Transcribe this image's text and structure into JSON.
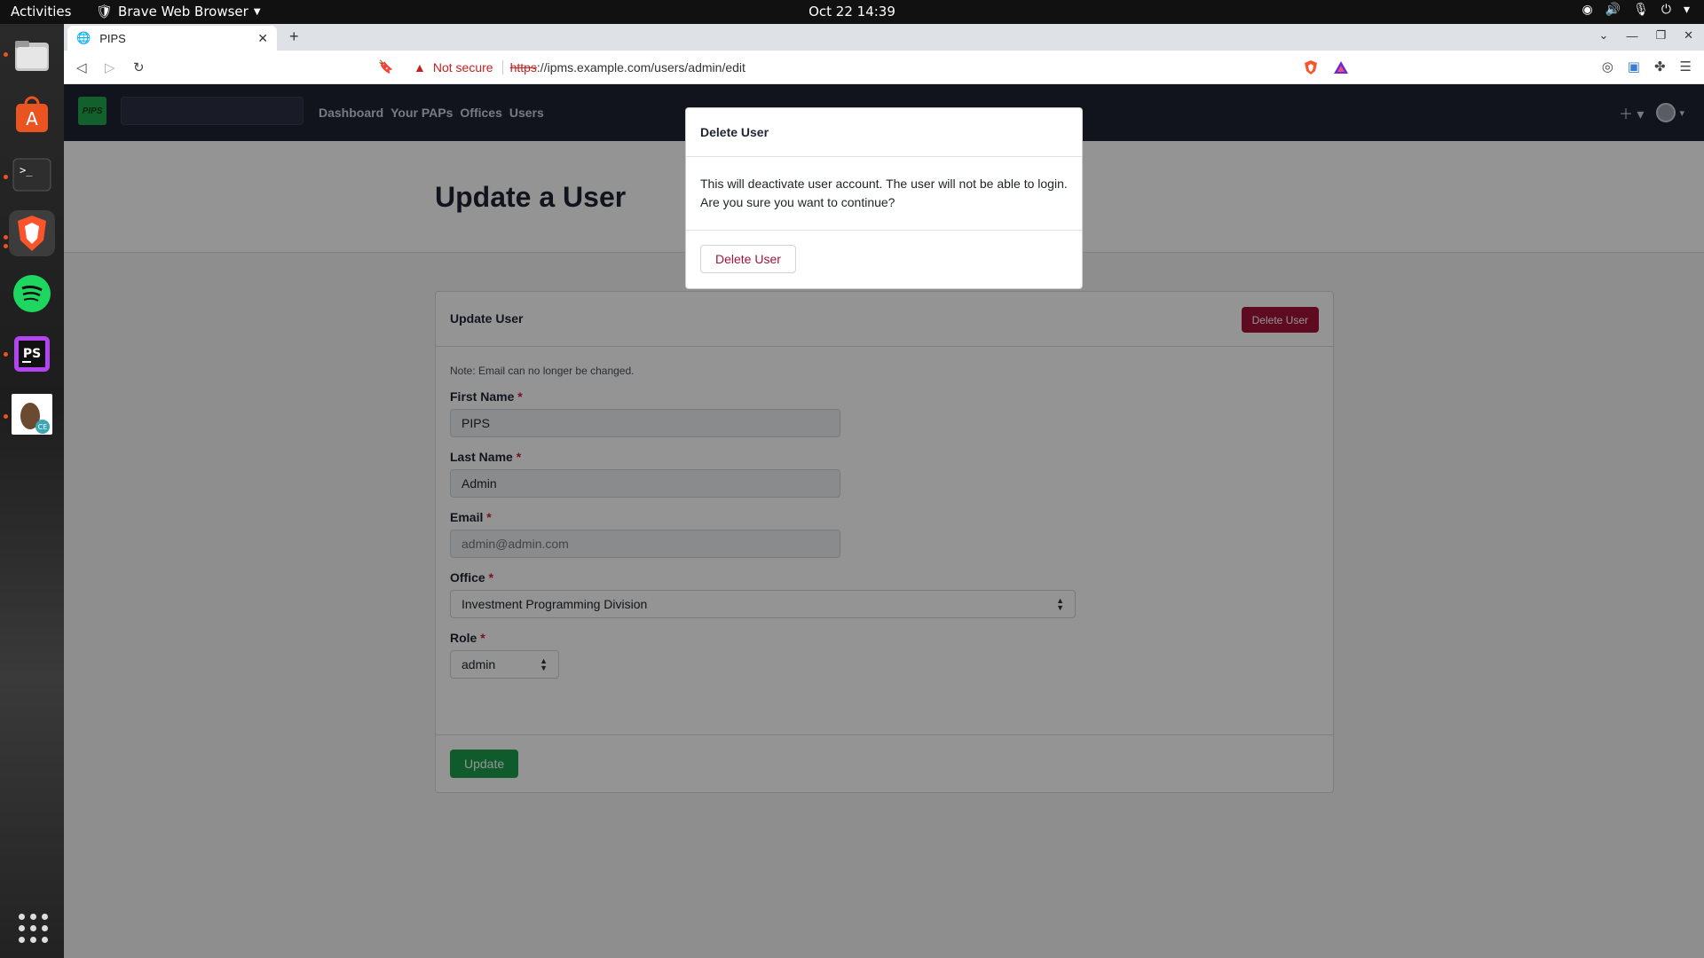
{
  "os": {
    "activities": "Activities",
    "app_menu": "Brave Web Browser",
    "clock": "Oct 22  14:39"
  },
  "browser": {
    "tab_title": "PIPS",
    "url_warning": "Not secure",
    "url_scheme": "https",
    "url_rest": "://ipms.example.com/users/admin/edit"
  },
  "app": {
    "logo_text": "PIPS",
    "nav": [
      "Dashboard",
      "Your PAPs",
      "Offices",
      "Users"
    ]
  },
  "page": {
    "title": "Update a User"
  },
  "card": {
    "title": "Update User",
    "delete_button": "Delete User",
    "note": "Note: Email can no longer be changed.",
    "fields": {
      "first_name": {
        "label": "First Name",
        "value": "PIPS"
      },
      "last_name": {
        "label": "Last Name",
        "value": "Admin"
      },
      "email": {
        "label": "Email",
        "placeholder": "admin@admin.com"
      },
      "office": {
        "label": "Office",
        "value": "Investment Programming Division"
      },
      "role": {
        "label": "Role",
        "value": "admin"
      }
    },
    "required_mark": "*",
    "update_button": "Update"
  },
  "modal": {
    "title": "Delete User",
    "body": "This will deactivate user account. The user will not be able to login. Are you sure you want to continue?",
    "confirm_button": "Delete User"
  },
  "colors": {
    "navbar": "#1f2433",
    "danger": "#a3143b",
    "success": "#1a9e4a",
    "logo_green": "#1fa64a"
  }
}
